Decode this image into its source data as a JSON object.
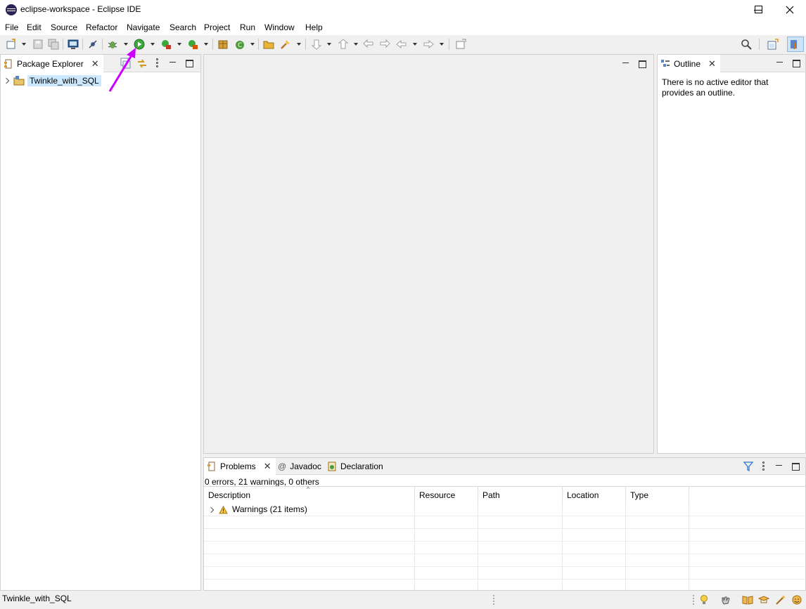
{
  "window": {
    "title": "eclipse-workspace - Eclipse IDE",
    "controls": [
      "minimize",
      "maximize",
      "close"
    ]
  },
  "menu": [
    "File",
    "Edit",
    "Source",
    "Refactor",
    "Navigate",
    "Search",
    "Project",
    "Run",
    "Window",
    "Help"
  ],
  "package_explorer": {
    "tab_label": "Package Explorer",
    "project": "Twinkle_with_SQL"
  },
  "outline": {
    "tab_label": "Outline",
    "message": "There is no active editor that provides an outline."
  },
  "bottom_panel": {
    "tabs": [
      "Problems",
      "Javadoc",
      "Declaration"
    ],
    "summary": "0 errors, 21 warnings, 0 others",
    "columns": [
      "Description",
      "Resource",
      "Path",
      "Location",
      "Type"
    ],
    "rows": [
      {
        "label": "Warnings (21 items)",
        "kind": "warning-group"
      }
    ]
  },
  "status_bar": {
    "text": "Twinkle_with_SQL"
  },
  "colors": {
    "annotation_arrow": "#cc00ff",
    "run_button": "#3aa83a",
    "selection": "#cce8ff",
    "warning": "#f5c242"
  }
}
